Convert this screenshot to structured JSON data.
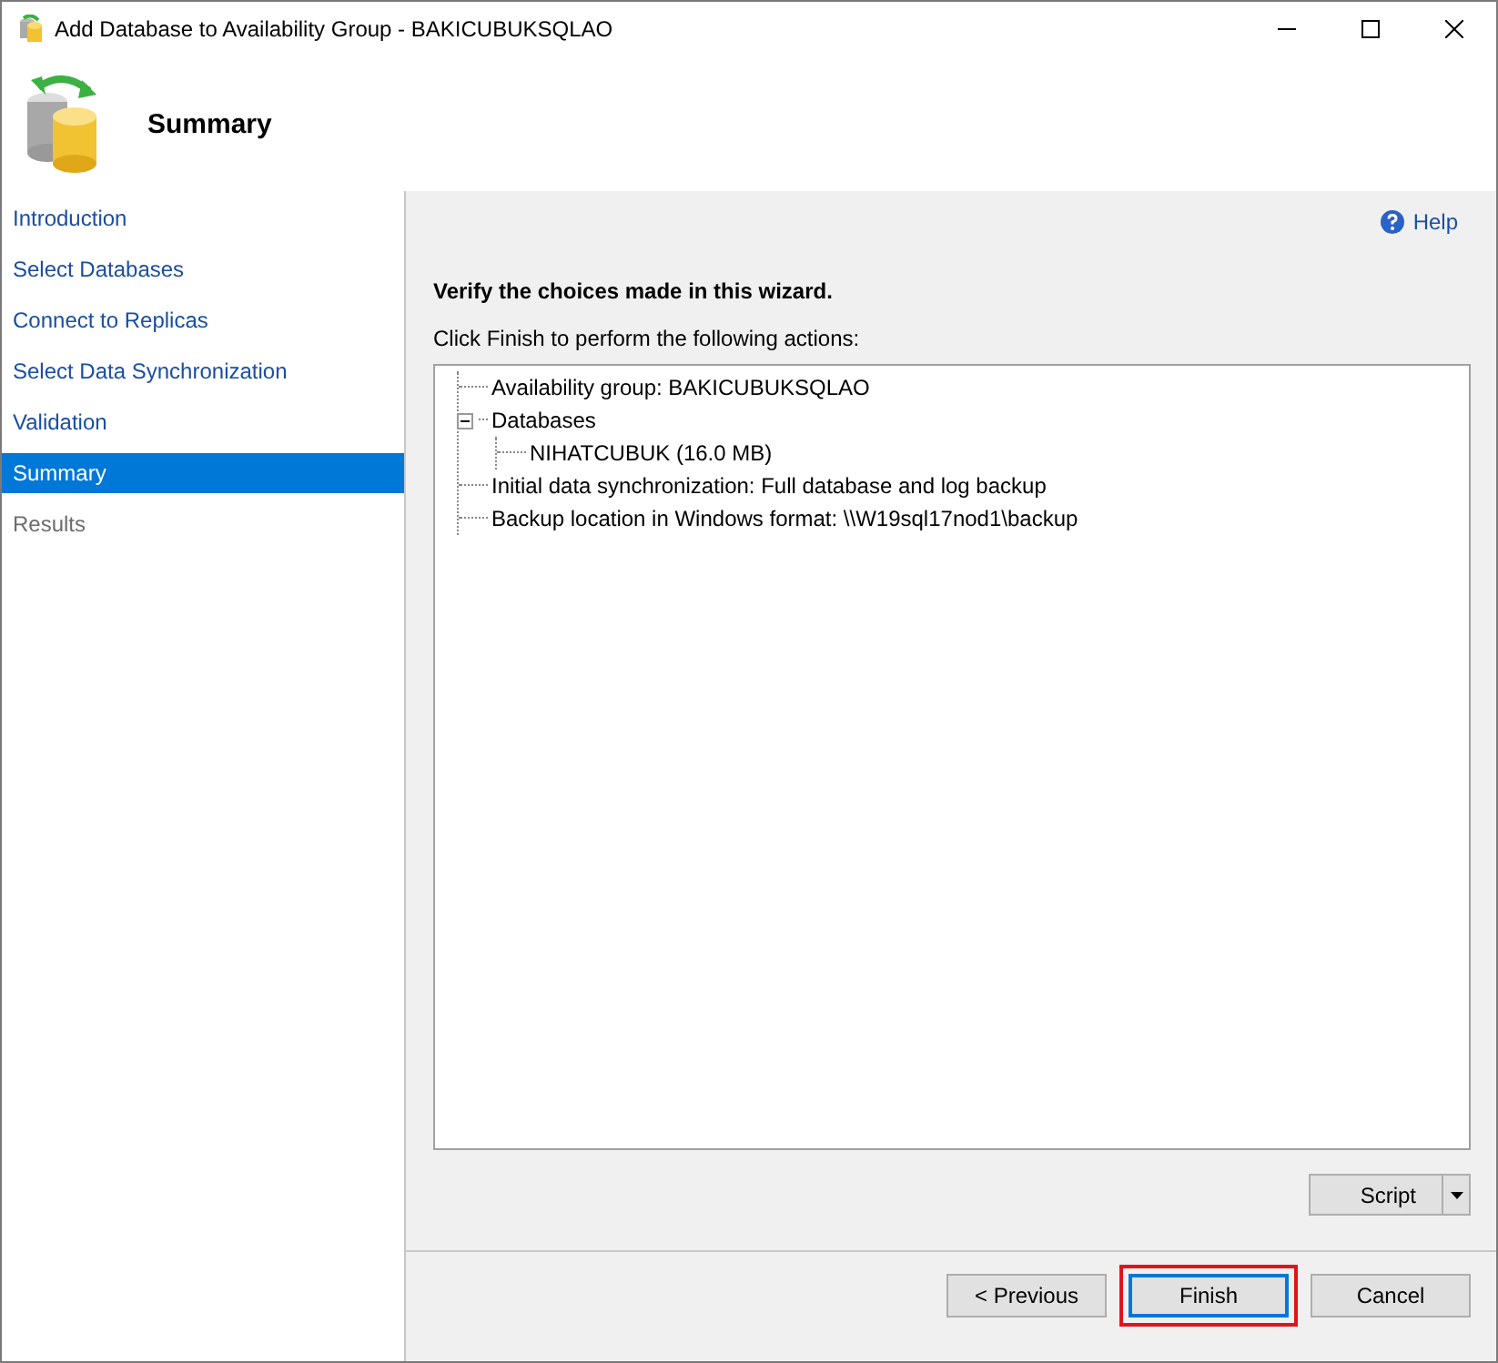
{
  "window": {
    "title": "Add Database to Availability Group - BAKICUBUKSQLAO"
  },
  "header": {
    "title": "Summary"
  },
  "sidebar": {
    "items": [
      {
        "label": "Introduction",
        "selected": false,
        "disabled": false
      },
      {
        "label": "Select Databases",
        "selected": false,
        "disabled": false
      },
      {
        "label": "Connect to Replicas",
        "selected": false,
        "disabled": false
      },
      {
        "label": "Select Data Synchronization",
        "selected": false,
        "disabled": false
      },
      {
        "label": "Validation",
        "selected": false,
        "disabled": false
      },
      {
        "label": "Summary",
        "selected": true,
        "disabled": false
      },
      {
        "label": "Results",
        "selected": false,
        "disabled": true
      }
    ]
  },
  "help": {
    "label": "Help"
  },
  "heading": "Verify the choices made in this wizard.",
  "instruction": "Click Finish to perform the following actions:",
  "tree": [
    {
      "label": "Availability group: BAKICUBUKSQLAO"
    },
    {
      "label": "Databases",
      "expanded": true,
      "children": [
        {
          "label": "NIHATCUBUK (16.0 MB)"
        }
      ]
    },
    {
      "label": "Initial data synchronization: Full database and log backup"
    },
    {
      "label": "Backup location in Windows format: \\\\W19sql17nod1\\backup"
    }
  ],
  "script_button": {
    "label": "Script"
  },
  "buttons": [
    {
      "label": "< Previous",
      "default": false,
      "highlighted": false
    },
    {
      "label": "Finish",
      "default": true,
      "highlighted": true
    },
    {
      "label": "Cancel",
      "default": false,
      "highlighted": false
    }
  ]
}
